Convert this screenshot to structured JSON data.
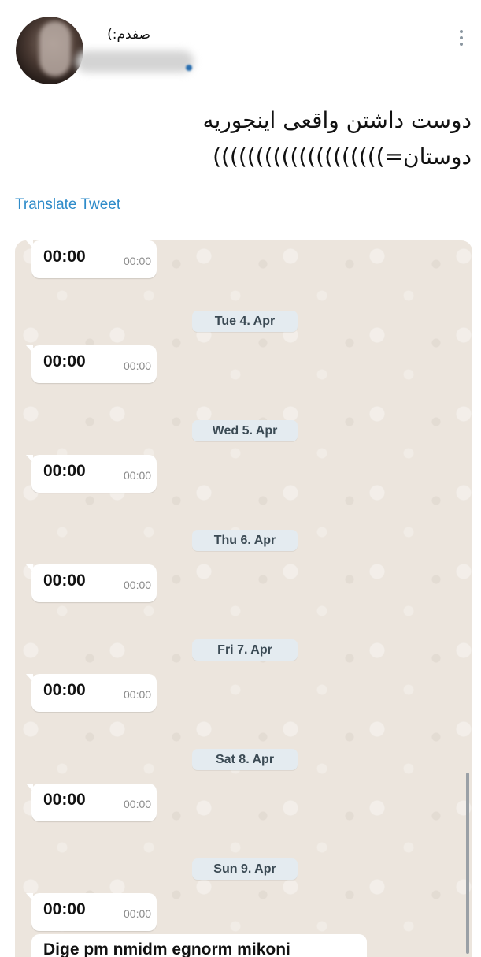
{
  "tweet": {
    "display_name": "صفدم:)",
    "text_line_1": "دوست داشتن واقعی اینجوریه",
    "text_line_2": "دوستان=))))))))))))))))))))",
    "translate_label": "Translate Tweet"
  },
  "chat": {
    "messages": [
      {
        "text": "00:00",
        "time": "00:00"
      },
      {
        "text": "00:00",
        "time": "00:00"
      },
      {
        "text": "00:00",
        "time": "00:00"
      },
      {
        "text": "00:00",
        "time": "00:00"
      },
      {
        "text": "00:00",
        "time": "00:00"
      },
      {
        "text": "00:00",
        "time": "00:00"
      },
      {
        "text": "00:00",
        "time": "00:00"
      }
    ],
    "dates": [
      "Tue 4. Apr",
      "Wed 5. Apr",
      "Thu 6. Apr",
      "Fri 7. Apr",
      "Sat 8. Apr",
      "Sun 9. Apr"
    ],
    "last_message": "Dige pm nmidm egnorm mikoni"
  },
  "icons": {
    "more": "vertical-ellipsis-icon"
  },
  "colors": {
    "link": "#2e8bc9",
    "chat_background": "#ece5dd",
    "date_pill": "#e4ebf0"
  }
}
